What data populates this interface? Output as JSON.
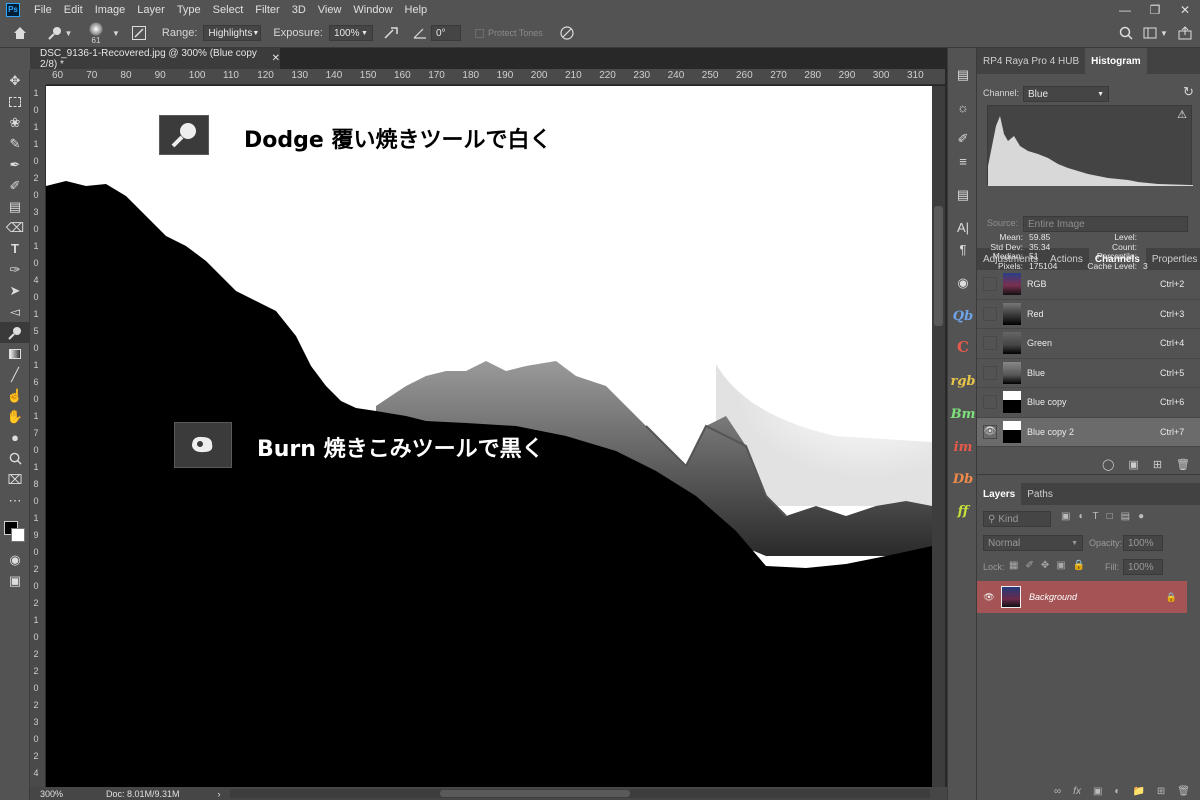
{
  "menubar": {
    "items": [
      "File",
      "Edit",
      "Image",
      "Layer",
      "Type",
      "Select",
      "Filter",
      "3D",
      "View",
      "Window",
      "Help"
    ]
  },
  "options": {
    "brush_size": "61",
    "range_label": "Range:",
    "range_value": "Highlights",
    "exposure_label": "Exposure:",
    "exposure_value": "100%",
    "angle_value": "0°",
    "protect_tones": "Protect Tones"
  },
  "document": {
    "tab_title": "DSC_9136-1-Recovered.jpg @ 300% (Blue copy 2/8) *",
    "ruler_top": [
      "60",
      "70",
      "80",
      "90",
      "100",
      "110",
      "120",
      "130",
      "140",
      "150",
      "160",
      "170",
      "180",
      "190",
      "200",
      "210",
      "220",
      "230",
      "240",
      "250",
      "260",
      "270",
      "280",
      "290",
      "300",
      "310"
    ],
    "ruler_left": [
      "1",
      "0",
      "1",
      "1",
      "0",
      "2",
      "0",
      "3",
      "0",
      "1",
      "0",
      "4",
      "0",
      "1",
      "5",
      "0",
      "1",
      "6",
      "0",
      "1",
      "7",
      "0",
      "1",
      "8",
      "0",
      "1",
      "9",
      "0",
      "2",
      "0",
      "2",
      "1",
      "0",
      "2",
      "2",
      "0",
      "2",
      "3",
      "0",
      "2",
      "4"
    ],
    "zoom": "300%",
    "doc_size": "Doc: 8.01M/9.31M",
    "annotation_dodge": "Dodge 覆い焼きツールで白く",
    "annotation_burn": "Burn 焼きこみツールで黒く"
  },
  "panels": {
    "top_tabs": [
      "RP4 Raya Pro 4 HUB",
      "Histogram"
    ],
    "histogram": {
      "channel_label": "Channel:",
      "channel_value": "Blue",
      "source_label": "Source:",
      "source_value": "Entire Image",
      "stats_left": [
        {
          "label": "Mean:",
          "value": "59.85"
        },
        {
          "label": "Std Dev:",
          "value": "35.34"
        },
        {
          "label": "Median:",
          "value": "51"
        },
        {
          "label": "Pixels:",
          "value": "175104"
        }
      ],
      "stats_right": [
        {
          "label": "Level:",
          "value": ""
        },
        {
          "label": "Count:",
          "value": ""
        },
        {
          "label": "Percentile:",
          "value": ""
        },
        {
          "label": "Cache Level:",
          "value": "3"
        }
      ]
    },
    "mid_tabs": [
      "Adjustments",
      "Actions",
      "Channels",
      "Properties"
    ],
    "channels": [
      {
        "name": "RGB",
        "key": "Ctrl+2",
        "visible": false,
        "selected": false
      },
      {
        "name": "Red",
        "key": "Ctrl+3",
        "visible": false,
        "selected": false
      },
      {
        "name": "Green",
        "key": "Ctrl+4",
        "visible": false,
        "selected": false
      },
      {
        "name": "Blue",
        "key": "Ctrl+5",
        "visible": false,
        "selected": false
      },
      {
        "name": "Blue copy",
        "key": "Ctrl+6",
        "visible": false,
        "selected": false
      },
      {
        "name": "Blue copy 2",
        "key": "Ctrl+7",
        "visible": true,
        "selected": true
      }
    ],
    "layers_tabs": [
      "Layers",
      "Paths"
    ],
    "layers": {
      "kind": "Kind",
      "blend": "Normal",
      "opacity_label": "Opacity:",
      "opacity_value": "100%",
      "lock_label": "Lock:",
      "fill_label": "Fill:",
      "fill_value": "100%",
      "items": [
        {
          "name": "Background"
        }
      ]
    }
  },
  "iconstrip": [
    "Qb",
    "C",
    "rgb",
    "Bm",
    "im",
    "Db",
    "ff"
  ],
  "colors": {
    "accent": "#31a8ff",
    "layer_selected": "#a45454"
  }
}
